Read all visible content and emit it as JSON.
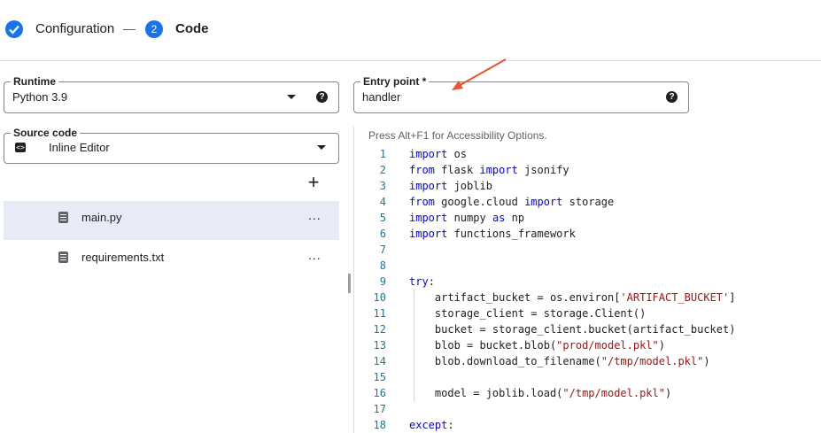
{
  "stepper": {
    "step1_label": "Configuration",
    "step2_number": "2",
    "step2_label": "Code"
  },
  "runtime": {
    "label": "Runtime",
    "value": "Python 3.9",
    "help": "?"
  },
  "entry_point": {
    "label": "Entry point *",
    "value": "handler",
    "help": "?"
  },
  "source_code": {
    "label": "Source code",
    "value": "Inline Editor",
    "icon": "<>"
  },
  "files": {
    "add": "+",
    "items": [
      {
        "name": "main.py",
        "more": "...",
        "selected": true
      },
      {
        "name": "requirements.txt",
        "more": "..."
      }
    ]
  },
  "editor": {
    "accessibility_hint": "Press Alt+F1 for Accessibility Options.",
    "lines": [
      {
        "n": "1",
        "tokens": [
          [
            "kw",
            "import"
          ],
          [
            "",
            "os"
          ]
        ],
        "text": "import os"
      },
      {
        "n": "2",
        "text": "from flask import jsonify"
      },
      {
        "n": "3",
        "text": "import joblib"
      },
      {
        "n": "4",
        "text": "from google.cloud import storage"
      },
      {
        "n": "5",
        "text": "import numpy as np"
      },
      {
        "n": "6",
        "text": "import functions_framework"
      },
      {
        "n": "7",
        "text": ""
      },
      {
        "n": "8",
        "text": ""
      },
      {
        "n": "9",
        "text": "try:"
      },
      {
        "n": "10",
        "text": "    artifact_bucket = os.environ['ARTIFACT_BUCKET']"
      },
      {
        "n": "11",
        "text": "    storage_client = storage.Client()"
      },
      {
        "n": "12",
        "text": "    bucket = storage_client.bucket(artifact_bucket)"
      },
      {
        "n": "13",
        "text": "    blob = bucket.blob(\"prod/model.pkl\")"
      },
      {
        "n": "14",
        "text": "    blob.download_to_filename(\"/tmp/model.pkl\")"
      },
      {
        "n": "15",
        "text": ""
      },
      {
        "n": "16",
        "text": "    model = joblib.load(\"/tmp/model.pkl\")"
      },
      {
        "n": "17",
        "text": ""
      },
      {
        "n": "18",
        "text": "except:"
      }
    ]
  },
  "colors": {
    "accent": "#1a73e8",
    "keyword": "#0000ff",
    "string": "#a31515",
    "line_number": "#237893",
    "arrow": "#e8542b",
    "selected_row": "#e8eaf6"
  }
}
